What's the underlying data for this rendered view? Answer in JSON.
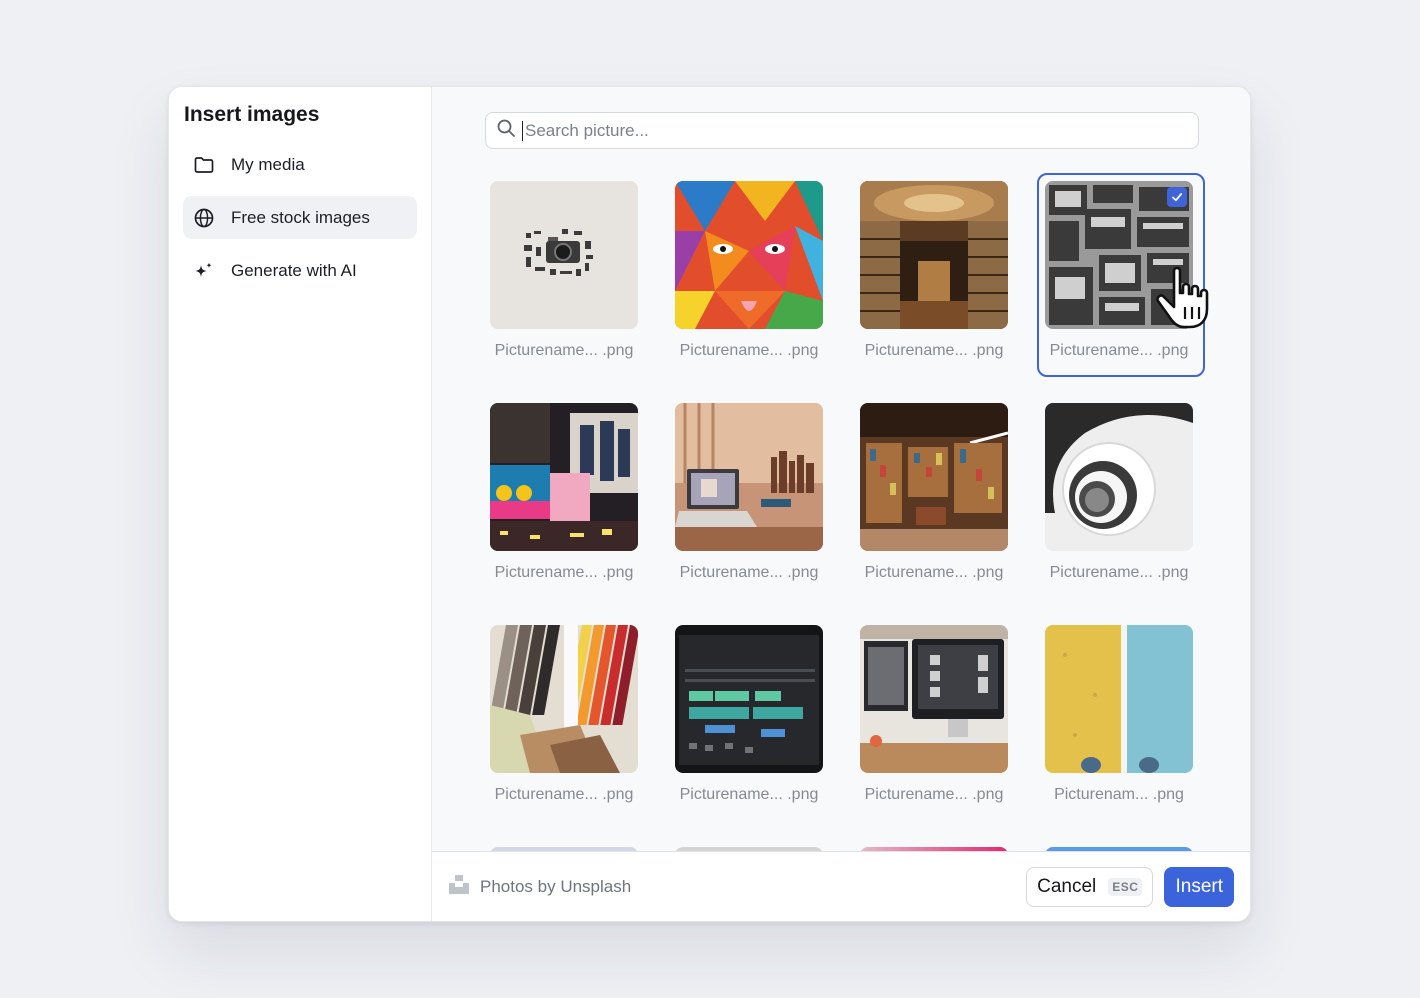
{
  "sidebar": {
    "title": "Insert images",
    "items": [
      {
        "label": "My media",
        "icon": "folder-icon"
      },
      {
        "label": "Free stock images",
        "icon": "globe-icon",
        "active": true
      },
      {
        "label": "Generate with AI",
        "icon": "sparkle-icon"
      }
    ]
  },
  "search": {
    "placeholder": "Search picture..."
  },
  "images": [
    {
      "caption": "Picturename... .png",
      "subject": "vintage camera flatlay",
      "selected": false
    },
    {
      "caption": "Picturename... .png",
      "subject": "colorful geometric mural",
      "selected": false
    },
    {
      "caption": "Picturename... .png",
      "subject": "ornate library interior",
      "selected": false
    },
    {
      "caption": "Picturename... .png",
      "subject": "black and white electronics wall",
      "selected": true
    },
    {
      "caption": "Picturename... .png",
      "subject": "times square billboards",
      "selected": false
    },
    {
      "caption": "Picturename... .png",
      "subject": "laptop on desk",
      "selected": false
    },
    {
      "caption": "Picturename... .png",
      "subject": "modern bookstore",
      "selected": false
    },
    {
      "caption": "Picturename... .png",
      "subject": "spiral staircase",
      "selected": false
    },
    {
      "caption": "Picturename... .png",
      "subject": "color swatches",
      "selected": false
    },
    {
      "caption": "Picturename... .png",
      "subject": "video editing timeline",
      "selected": false
    },
    {
      "caption": "Picturename... .png",
      "subject": "monitor workspace",
      "selected": false
    },
    {
      "caption": "Picturenam... .png",
      "subject": "yellow and blue wall",
      "selected": false
    }
  ],
  "footer": {
    "credit": "Photos by Unsplash",
    "cancel_label": "Cancel",
    "cancel_shortcut": "ESC",
    "insert_label": "Insert"
  },
  "colors": {
    "accent": "#3a63dc",
    "selection": "#3f63d9"
  }
}
